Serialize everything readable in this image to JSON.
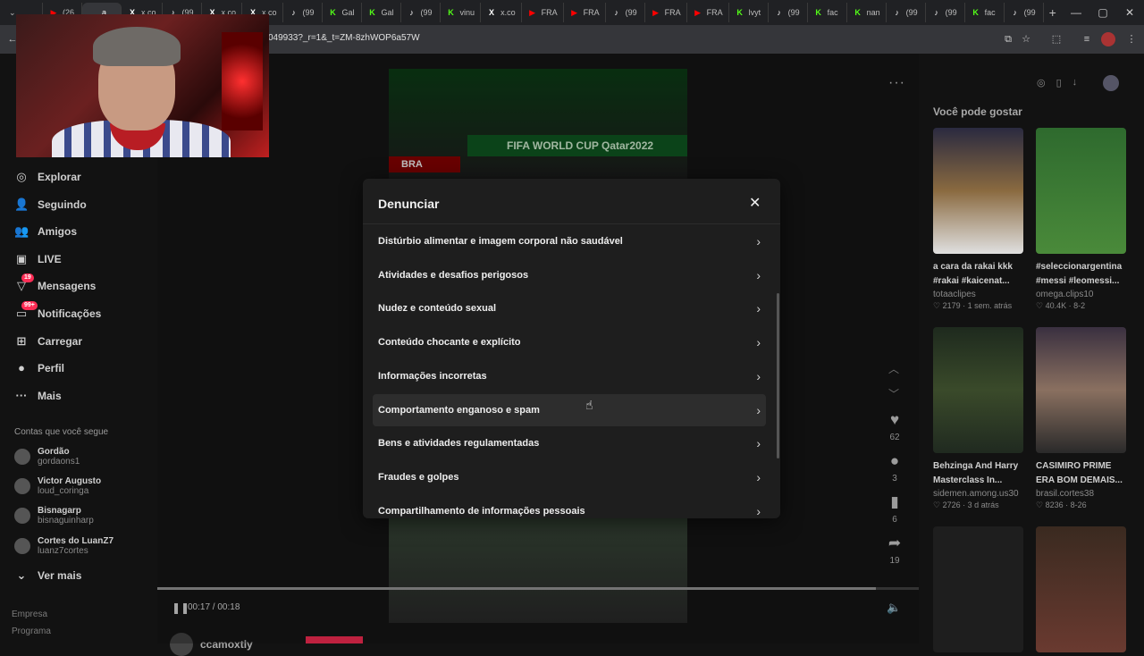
{
  "tabs": [
    {
      "label": "(26",
      "fav": "▶",
      "color": "#ff0000"
    },
    {
      "label": "a",
      "fav": "",
      "color": "#888888",
      "active": true
    },
    {
      "label": "x.co",
      "fav": "X",
      "color": "#ffffff"
    },
    {
      "label": "(99",
      "fav": "♪",
      "color": "#ffffff"
    },
    {
      "label": "x.co",
      "fav": "X",
      "color": "#ffffff"
    },
    {
      "label": "x.co",
      "fav": "X",
      "color": "#ffffff"
    },
    {
      "label": "(99",
      "fav": "♪",
      "color": "#ffffff"
    },
    {
      "label": "Gal",
      "fav": "K",
      "color": "#53fc18"
    },
    {
      "label": "Gal",
      "fav": "K",
      "color": "#53fc18"
    },
    {
      "label": "(99",
      "fav": "♪",
      "color": "#ffffff"
    },
    {
      "label": "vinu",
      "fav": "K",
      "color": "#53fc18"
    },
    {
      "label": "x.co",
      "fav": "X",
      "color": "#ffffff"
    },
    {
      "label": "FRA",
      "fav": "▶",
      "color": "#ff0000"
    },
    {
      "label": "FRA",
      "fav": "▶",
      "color": "#ff0000"
    },
    {
      "label": "(99",
      "fav": "♪",
      "color": "#ffffff"
    },
    {
      "label": "FRA",
      "fav": "▶",
      "color": "#ff0000"
    },
    {
      "label": "FRA",
      "fav": "▶",
      "color": "#ff0000"
    },
    {
      "label": "lvyt",
      "fav": "K",
      "color": "#53fc18"
    },
    {
      "label": "(99",
      "fav": "♪",
      "color": "#ffffff"
    },
    {
      "label": "fac",
      "fav": "K",
      "color": "#53fc18"
    },
    {
      "label": "nan",
      "fav": "K",
      "color": "#53fc18"
    },
    {
      "label": "(99",
      "fav": "♪",
      "color": "#ffffff"
    },
    {
      "label": "(99",
      "fav": "♪",
      "color": "#ffffff"
    },
    {
      "label": "fac",
      "fav": "K",
      "color": "#53fc18"
    },
    {
      "label": "(99",
      "fav": "♪",
      "color": "#ffffff"
    }
  ],
  "browser": {
    "new_tab": "+",
    "minimize": "—",
    "maximize": "▢",
    "close": "✕",
    "url": "049933?_r=1&_t=ZM-8zhWOP6a57W"
  },
  "sidebar": {
    "nav": [
      {
        "label": "Explorar",
        "icon": "◎"
      },
      {
        "label": "Seguindo",
        "icon": "👤"
      },
      {
        "label": "Amigos",
        "icon": "👥"
      },
      {
        "label": "LIVE",
        "icon": "▣"
      },
      {
        "label": "Mensagens",
        "icon": "▽",
        "badge": "19"
      },
      {
        "label": "Notificações",
        "icon": "▭",
        "badge": "99+"
      },
      {
        "label": "Carregar",
        "icon": "⊞"
      },
      {
        "label": "Perfil",
        "icon": "●"
      },
      {
        "label": "Mais",
        "icon": "···"
      }
    ],
    "following_title": "Contas que você segue",
    "accounts": [
      {
        "name": "Gordão",
        "user": "gordaons1"
      },
      {
        "name": "Victor Augusto",
        "user": "loud_coringa"
      },
      {
        "name": "Bisnagarp",
        "user": "bisnaguinharp"
      },
      {
        "name": "Cortes do LuanZ7",
        "user": "luanz7cortes"
      }
    ],
    "see_more": "Ver mais",
    "footer": [
      "Empresa",
      "Programa"
    ]
  },
  "video": {
    "banner": "FIFA WORLD CUP Qatar2022",
    "score": "BRA",
    "time": "00:17 / 00:18",
    "progress": 0.944,
    "author": "ccamoxtly"
  },
  "actions": {
    "likes": "62",
    "comments": "3",
    "saves": "6",
    "shares": "19"
  },
  "modal": {
    "title": "Denunciar",
    "options": [
      "Distúrbio alimentar e imagem corporal não saudável",
      "Atividades e desafios perigosos",
      "Nudez e conteúdo sexual",
      "Conteúdo chocante e explícito",
      "Informações incorretas",
      "Comportamento enganoso e spam",
      "Bens e atividades regulamentadas",
      "Fraudes e golpes",
      "Compartilhamento de informações pessoais"
    ],
    "hovered_index": 5
  },
  "right": {
    "title": "Você pode gostar",
    "cards": [
      {
        "title": "a cara da rakai kkk #rakai #kaicenat...",
        "user": "totaaclipes",
        "likes": "2179",
        "when": "1 sem. atrás"
      },
      {
        "title": "#seleccionargentina #messi #leomessi...",
        "user": "omega.clips10",
        "likes": "40.4K",
        "when": "8-2"
      },
      {
        "title": "Behzinga And Harry Masterclass In...",
        "user": "sidemen.among.us30",
        "likes": "2726",
        "when": "3 d atrás"
      },
      {
        "title": "CASIMIRO PRIME ERA BOM DEMAIS...",
        "user": "brasil.cortes38",
        "likes": "8236",
        "when": "8-26"
      }
    ]
  }
}
